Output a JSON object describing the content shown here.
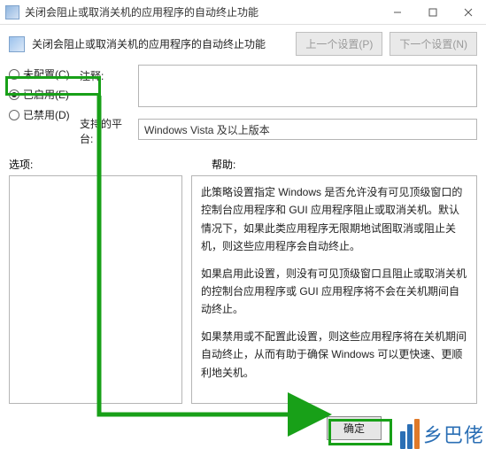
{
  "window": {
    "title": "关闭会阻止或取消关机的应用程序的自动终止功能"
  },
  "header": {
    "title": "关闭会阻止或取消关机的应用程序的自动终止功能",
    "prev_btn": "上一个设置(P)",
    "next_btn": "下一个设置(N)"
  },
  "radios": {
    "not_configured": "未配置(C)",
    "enabled": "已启用(E)",
    "disabled": "已禁用(D)"
  },
  "fields": {
    "comment_label": "注释:",
    "platform_label": "支持的平台:",
    "platform_value": "Windows Vista 及以上版本"
  },
  "sections": {
    "options_label": "选项:",
    "help_label": "帮助:"
  },
  "help": {
    "p1": "此策略设置指定 Windows 是否允许没有可见顶级窗口的控制台应用程序和 GUI 应用程序阻止或取消关机。默认情况下，如果此类应用程序无限期地试图取消或阻止关机，则这些应用程序会自动终止。",
    "p2": "如果启用此设置，则没有可见顶级窗口且阻止或取消关机的控制台应用程序或 GUI 应用程序将不会在关机期间自动终止。",
    "p3": "如果禁用或不配置此设置，则这些应用程序将在关机期间自动终止，从而有助于确保 Windows 可以更快速、更顺利地关机。"
  },
  "footer": {
    "ok": "确定"
  },
  "watermark": {
    "text": "乡巴佬"
  }
}
